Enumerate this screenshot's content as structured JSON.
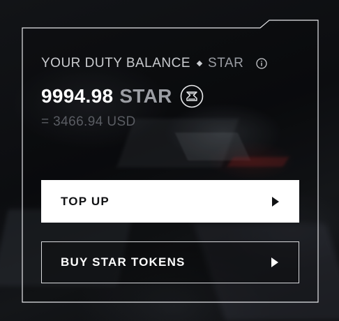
{
  "balance": {
    "label": "YOUR DUTY BALANCE",
    "label_unit": "STAR",
    "amount": "9994.98",
    "amount_unit": "STAR",
    "usd_equivalent": "= 3466.94 USD"
  },
  "icons": {
    "info": "info-icon",
    "token": "star-token-icon",
    "arrow": "caret-right-icon"
  },
  "buttons": {
    "top_up": "TOP UP",
    "buy_tokens": "BUY STAR TOKENS"
  },
  "colors": {
    "primary_button_bg": "#ffffff",
    "primary_button_text": "#111214",
    "secondary_button_border": "#d9dadd",
    "frame_border": "#e6e7ea"
  }
}
